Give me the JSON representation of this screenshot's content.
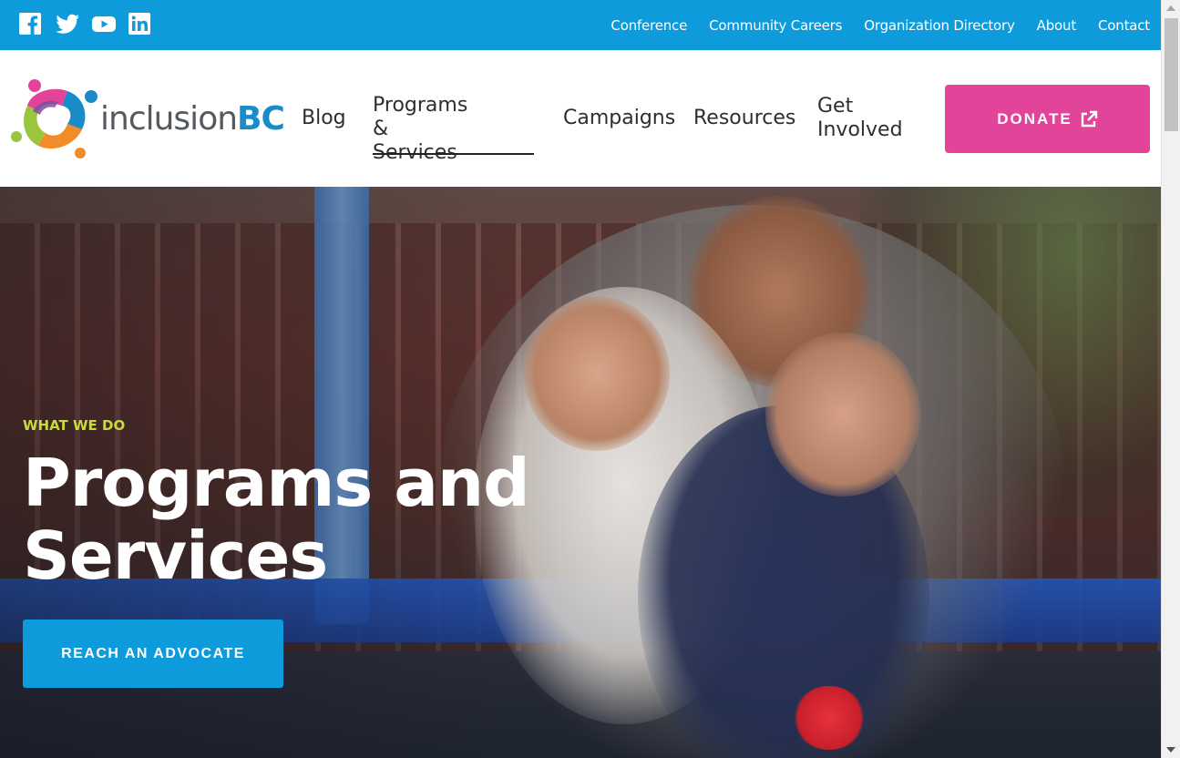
{
  "topbar": {
    "social": [
      {
        "icon": "facebook-icon"
      },
      {
        "icon": "twitter-icon"
      },
      {
        "icon": "youtube-icon"
      },
      {
        "icon": "linkedin-icon"
      }
    ],
    "links": [
      "Conference",
      "Community Careers",
      "Organization Directory",
      "About",
      "Contact"
    ],
    "color": "#0d9bdc"
  },
  "header": {
    "logo": {
      "prefix": "inclusion",
      "suffix": "BC"
    },
    "nav": {
      "blog": "Blog",
      "programs_line1": "Programs &",
      "programs_line2": "Services",
      "campaigns": "Campaigns",
      "resources": "Resources",
      "involved_line1": "Get",
      "involved_line2": "Involved"
    },
    "donate": {
      "label": "DONATE",
      "icon": "external-link-icon",
      "color": "#e2449a"
    }
  },
  "hero": {
    "eyebrow": "WHAT WE DO",
    "title_line1": "Programs and",
    "title_line2": "Services",
    "cta": "REACH AN ADVOCATE",
    "eyebrow_color": "#c5dc3a"
  }
}
